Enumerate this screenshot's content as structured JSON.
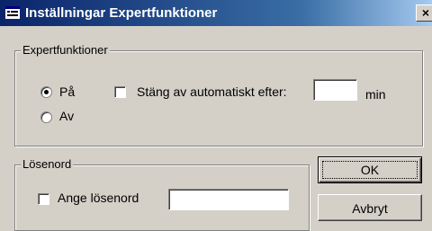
{
  "window": {
    "title": "Inställningar Expertfunktioner",
    "close_glyph": "×",
    "icon": "app-window-icon"
  },
  "expert_group": {
    "legend": "Expertfunktioner",
    "radio_on_label": "På",
    "radio_on_selected": true,
    "radio_off_label": "Av",
    "radio_off_selected": false,
    "auto_off_label": "Stäng av automatiskt efter:",
    "auto_off_checked": false,
    "auto_off_value": "",
    "unit_label": "min"
  },
  "password_group": {
    "legend": "Lösenord",
    "set_password_label": "Ange lösenord",
    "set_password_checked": false,
    "password_value": ""
  },
  "buttons": {
    "ok_label": "OK",
    "cancel_label": "Avbryt"
  }
}
